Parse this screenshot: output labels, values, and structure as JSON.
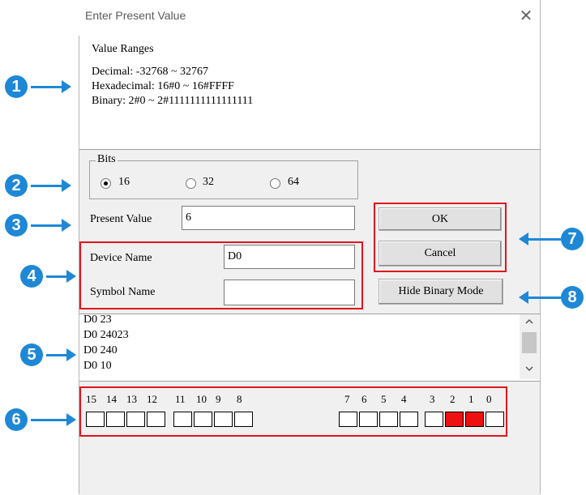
{
  "dialog": {
    "title": "Enter Present Value",
    "close_glyph": "✕"
  },
  "value_ranges": {
    "heading": "Value Ranges",
    "decimal": "Decimal: -32768 ~ 32767",
    "hexadecimal": "Hexadecimal: 16#0 ~ 16#FFFF",
    "binary": "Binary: 2#0 ~ 2#1111111111111111"
  },
  "bits": {
    "label": "Bits",
    "options": [
      "16",
      "32",
      "64"
    ],
    "selected": "16"
  },
  "present_value": {
    "label": "Present Value",
    "value": "6"
  },
  "device_name": {
    "label": "Device Name",
    "value": "D0"
  },
  "symbol_name": {
    "label": "Symbol Name",
    "value": ""
  },
  "buttons": {
    "ok": "OK",
    "cancel": "Cancel",
    "hide_binary": "Hide Binary Mode"
  },
  "history": [
    "D0 23",
    "D0 24023",
    "D0 240",
    "D0 10"
  ],
  "bit_labels": [
    "15",
    "14",
    "13",
    "12",
    "11",
    "10",
    "9",
    "8",
    "7",
    "6",
    "5",
    "4",
    "3",
    "2",
    "1",
    "0"
  ],
  "bit_states": [
    0,
    0,
    0,
    0,
    0,
    0,
    0,
    0,
    0,
    0,
    0,
    0,
    0,
    1,
    1,
    0
  ],
  "callouts": [
    "1",
    "2",
    "3",
    "4",
    "5",
    "6",
    "7",
    "8"
  ],
  "colors": {
    "callout": "#1e88d6",
    "highlight": "#e0141e",
    "bit_on": "#ee1111"
  },
  "icons": {
    "close": "close-icon",
    "scroll_up": "chevron-up-icon",
    "scroll_down": "chevron-down-icon"
  }
}
